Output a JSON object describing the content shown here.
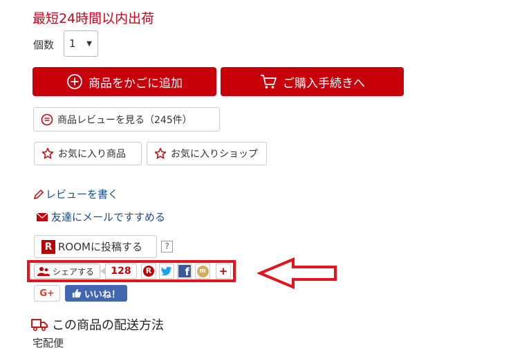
{
  "shipping_note": "最短24時間以内出荷",
  "quantity": {
    "label": "個数",
    "value": "1"
  },
  "buttons": {
    "add_to_cart": "商品をかごに追加",
    "checkout": "ご購入手続きへ",
    "reviews": "商品レビューを見る（245件）",
    "fav_item": "お気に入り商品",
    "fav_shop": "お気に入りショップ"
  },
  "links": {
    "write_review": "レビューを書く",
    "email_friend": "友達にメールですすめる"
  },
  "room": {
    "label": "ROOMに投稿する",
    "help": "?"
  },
  "share": {
    "label": "シェアする",
    "count": "128"
  },
  "social": {
    "google_plus": "G+",
    "facebook_like": "いいね！"
  },
  "delivery": {
    "title": "この商品の配送方法",
    "method": "宅配便"
  },
  "colors": {
    "accent_red": "#c8000a",
    "link_blue": "#1a4b8c",
    "highlight_frame": "#e5131d",
    "facebook": "#4267b2"
  }
}
